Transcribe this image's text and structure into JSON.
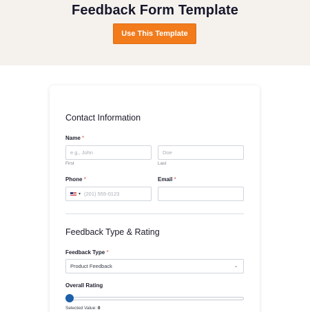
{
  "hero": {
    "title": "Feedback Form Template",
    "cta_label": "Use This Template"
  },
  "form": {
    "contact_section": {
      "title": "Contact Information",
      "name_label": "Name",
      "required_mark": "*",
      "first_placeholder": "e.g., John",
      "last_placeholder": "Doe",
      "first_sublabel": "First",
      "last_sublabel": "Last",
      "phone_label": "Phone",
      "phone_placeholder": "(201) 555-0123",
      "phone_country_icon": "us-flag-icon",
      "email_label": "Email",
      "email_value": ""
    },
    "feedback_section": {
      "title": "Feedback Type & Rating",
      "type_label": "Feedback Type",
      "type_selected": "Product Feedback",
      "rating_label": "Overall Rating",
      "selected_value_label": "Selected Value:",
      "selected_value": "0",
      "rating_level": 0
    }
  },
  "colors": {
    "hero_bg": "#f5f2ee",
    "accent": "#f27b1c",
    "required": "#d9534f",
    "slider_thumb": "#1d5fa8"
  }
}
